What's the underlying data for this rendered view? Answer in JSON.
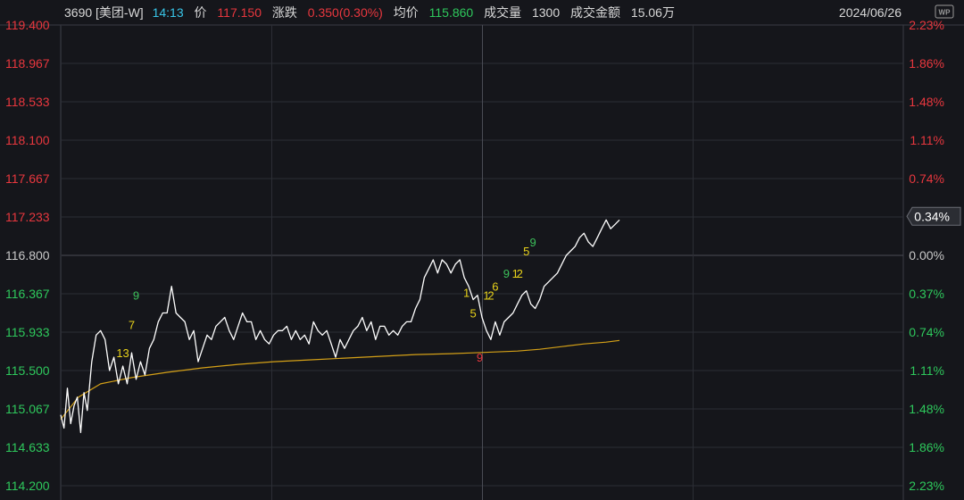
{
  "header": {
    "code": "3690",
    "name": "[美团-W]",
    "time": "14:13",
    "price_label": "价",
    "price": "117.150",
    "change_label": "涨跌",
    "change": "0.350(0.30%)",
    "avg_label": "均价",
    "avg": "115.860",
    "volume_label": "成交量",
    "volume": "1300",
    "amount_label": "成交金额",
    "amount": "15.06万",
    "date": "2024/06/26"
  },
  "watermark_icon": "wp-logo-icon",
  "colors": {
    "background": "#15161b",
    "price_line": "#ffffff",
    "avg_line": "#d4a017",
    "up": "#e8373e",
    "down": "#2ec85c",
    "code_text": "#d8d8d8",
    "time_text": "#38c5e8",
    "date_text": "#d8d8d8",
    "grid": "#3a3c44",
    "signal_yellow": "#e8d21a",
    "signal_green": "#3cc05a",
    "signal_red": "#e8373e"
  },
  "current_badge": "0.34%",
  "chart_data": {
    "type": "line",
    "title": "",
    "ylim": [
      114.2,
      119.4
    ],
    "left_ticks": [
      {
        "v": 119.4,
        "label": "119.400",
        "c": "up"
      },
      {
        "v": 118.967,
        "label": "118.967",
        "c": "up"
      },
      {
        "v": 118.533,
        "label": "118.533",
        "c": "up"
      },
      {
        "v": 118.1,
        "label": "118.100",
        "c": "up"
      },
      {
        "v": 117.667,
        "label": "117.667",
        "c": "up"
      },
      {
        "v": 117.233,
        "label": "117.233",
        "c": "up"
      },
      {
        "v": 116.8,
        "label": "116.800",
        "c": "neutral"
      },
      {
        "v": 116.367,
        "label": "116.367",
        "c": "down"
      },
      {
        "v": 115.933,
        "label": "115.933",
        "c": "down"
      },
      {
        "v": 115.5,
        "label": "115.500",
        "c": "down"
      },
      {
        "v": 115.067,
        "label": "115.067",
        "c": "down"
      },
      {
        "v": 114.633,
        "label": "114.633",
        "c": "down"
      },
      {
        "v": 114.2,
        "label": "114.200",
        "c": "down"
      }
    ],
    "right_ticks": [
      {
        "v": 119.4,
        "label": "2.23%",
        "c": "up"
      },
      {
        "v": 118.967,
        "label": "1.86%",
        "c": "up"
      },
      {
        "v": 118.533,
        "label": "1.48%",
        "c": "up"
      },
      {
        "v": 118.1,
        "label": "1.11%",
        "c": "up"
      },
      {
        "v": 117.667,
        "label": "0.74%",
        "c": "up"
      },
      {
        "v": 116.8,
        "label": "0.00%",
        "c": "neutral"
      },
      {
        "v": 116.367,
        "label": "0.37%",
        "c": "down"
      },
      {
        "v": 115.933,
        "label": "0.74%",
        "c": "down"
      },
      {
        "v": 115.5,
        "label": "1.11%",
        "c": "down"
      },
      {
        "v": 115.067,
        "label": "1.48%",
        "c": "down"
      },
      {
        "v": 114.633,
        "label": "1.86%",
        "c": "down"
      },
      {
        "v": 114.2,
        "label": "2.23%",
        "c": "down"
      }
    ],
    "series": [
      {
        "role": "price",
        "values": [
          115.0,
          114.85,
          115.3,
          114.9,
          115.1,
          115.2,
          114.8,
          115.25,
          115.05,
          115.6,
          115.9,
          115.95,
          115.85,
          115.5,
          115.65,
          115.35,
          115.55,
          115.35,
          115.7,
          115.4,
          115.6,
          115.45,
          115.75,
          115.85,
          116.05,
          116.15,
          116.15,
          116.45,
          116.15,
          116.1,
          116.05,
          115.85,
          115.95,
          115.6,
          115.75,
          115.9,
          115.85,
          116.0,
          116.05,
          116.1,
          115.95,
          115.85,
          116.0,
          116.15,
          116.05,
          116.05,
          115.85,
          115.95,
          115.85,
          115.8,
          115.9,
          115.95,
          115.95,
          116.0,
          115.85,
          115.95,
          115.85,
          115.9,
          115.8,
          116.05,
          115.95,
          115.9,
          115.95,
          115.8,
          115.65,
          115.85,
          115.75,
          115.85,
          115.95,
          116.0,
          116.1,
          115.95,
          116.05,
          115.85,
          116.0,
          116.0,
          115.9,
          115.95,
          115.9,
          116.0,
          116.05,
          116.05,
          116.2,
          116.3,
          116.55,
          116.65,
          116.75,
          116.6,
          116.75,
          116.7,
          116.6,
          116.7,
          116.75,
          116.55,
          116.45,
          116.3,
          116.35,
          116.1,
          115.95,
          115.85,
          116.05,
          115.9,
          116.05,
          116.1,
          116.15,
          116.25,
          116.35,
          116.4,
          116.25,
          116.2,
          116.3,
          116.45,
          116.5,
          116.55,
          116.6,
          116.7,
          116.8,
          116.85,
          116.9,
          117.0,
          117.05,
          116.95,
          116.9,
          117.0,
          117.1,
          117.2,
          117.1,
          117.15,
          117.2
        ],
        "x": [
          0.0,
          1.5,
          3.0,
          4.5,
          6.0,
          7.5,
          9.0,
          10.5,
          12.0,
          14.0,
          16.0,
          18.0,
          20.0,
          22.0,
          24.0,
          26.0,
          28.0,
          30.0,
          32.0,
          34.0,
          36.0,
          38.0,
          40.0,
          42.0,
          44.0,
          46.0,
          48.0,
          50.0,
          52.0,
          54.0,
          56.0,
          58.0,
          60.0,
          62.0,
          64.0,
          66.0,
          68.0,
          70.0,
          72.0,
          74.0,
          76.0,
          78.0,
          80.0,
          82.0,
          84.0,
          86.0,
          88.0,
          90.0,
          92.0,
          94.0,
          96.0,
          98.0,
          100.0,
          102.0,
          104.0,
          106.0,
          108.0,
          110.0,
          112.0,
          114.0,
          116.0,
          118.0,
          120.0,
          122.0,
          124.0,
          126.0,
          128.0,
          130.0,
          132.0,
          134.0,
          136.0,
          138.0,
          140.0,
          142.0,
          144.0,
          146.0,
          148.0,
          150.0,
          152.0,
          154.0,
          156.0,
          158.0,
          160.0,
          162.0,
          164.0,
          166.0,
          168.0,
          170.0,
          172.0,
          174.0,
          176.0,
          178.0,
          180.0,
          182.0,
          184.0,
          186.0,
          188.0,
          190.0,
          192.0,
          194.0,
          196.0,
          198.0,
          200.0,
          202.0,
          204.0,
          206.0,
          208.0,
          210.0,
          212.0,
          214.0,
          216.0,
          218.0,
          220.0,
          222.0,
          224.0,
          226.0,
          228.0,
          230.0,
          232.0,
          234.0,
          236.0,
          238.0,
          240.0,
          242.0,
          244.0,
          246.0,
          248.0,
          250.0,
          252.0
        ]
      },
      {
        "role": "average",
        "values": [
          114.95,
          115.2,
          115.35,
          115.42,
          115.48,
          115.53,
          115.57,
          115.6,
          115.62,
          115.64,
          115.66,
          115.68,
          115.69,
          115.7,
          115.71,
          115.72,
          115.74,
          115.77,
          115.8,
          115.82,
          115.84
        ],
        "x": [
          0,
          8,
          18,
          32,
          48,
          64,
          80,
          96,
          112,
          128,
          144,
          160,
          176,
          186,
          196,
          206,
          216,
          226,
          236,
          246,
          252
        ]
      }
    ],
    "signals": [
      {
        "text": "13",
        "x": 28,
        "v": 115.7,
        "c": "yellow"
      },
      {
        "text": "7",
        "x": 32,
        "v": 116.02,
        "c": "yellow"
      },
      {
        "text": "9",
        "x": 34,
        "v": 116.35,
        "c": "green"
      },
      {
        "text": "1",
        "x": 183,
        "v": 116.38,
        "c": "yellow"
      },
      {
        "text": "5",
        "x": 186,
        "v": 116.15,
        "c": "yellow"
      },
      {
        "text": "9",
        "x": 189,
        "v": 115.65,
        "c": "red"
      },
      {
        "text": "1",
        "x": 192,
        "v": 116.35,
        "c": "yellow"
      },
      {
        "text": "2",
        "x": 194,
        "v": 116.35,
        "c": "yellow"
      },
      {
        "text": "6",
        "x": 196,
        "v": 116.45,
        "c": "yellow"
      },
      {
        "text": "9",
        "x": 201,
        "v": 116.6,
        "c": "green"
      },
      {
        "text": "1",
        "x": 205,
        "v": 116.6,
        "c": "yellow"
      },
      {
        "text": "2",
        "x": 207,
        "v": 116.6,
        "c": "yellow"
      },
      {
        "text": "5",
        "x": 210,
        "v": 116.85,
        "c": "yellow"
      },
      {
        "text": "9",
        "x": 213,
        "v": 116.95,
        "c": "green"
      }
    ],
    "grid": true
  }
}
